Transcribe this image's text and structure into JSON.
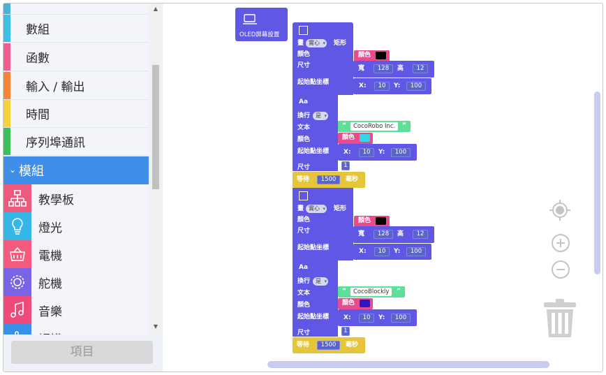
{
  "toolbox": {
    "categories": [
      {
        "label": "",
        "color": "#46b5d8"
      },
      {
        "label": "數組",
        "color": "#3ec0e6"
      },
      {
        "label": "函數",
        "color": "#f15f8e"
      },
      {
        "label": "輸入 / 輸出",
        "color": "#f58638"
      },
      {
        "label": "時間",
        "color": "#f5d23c"
      },
      {
        "label": "序列埠通訊",
        "color": "#3bbf5a"
      }
    ],
    "selected": {
      "label": "模組",
      "color": "#3f8ee9"
    },
    "modules": [
      {
        "label": "教學板",
        "icon": "board-icon",
        "color": "#ee5a7d"
      },
      {
        "label": "燈光",
        "icon": "bulb-icon",
        "color": "#36b7e8"
      },
      {
        "label": "電機",
        "icon": "motor-icon",
        "color": "#f35a7e"
      },
      {
        "label": "舵機",
        "icon": "servo-icon",
        "color": "#7a63e4"
      },
      {
        "label": "音樂",
        "icon": "music-icon",
        "color": "#ef4b7a"
      },
      {
        "label": "觸摸",
        "icon": "touch-icon",
        "color": "#3a8fe8"
      }
    ],
    "items_button": "項目"
  },
  "hat_block": {
    "label": "OLED屏幕設置",
    "icon": "screen-icon"
  },
  "rect_blocks": [
    {
      "draw_label": "畫",
      "mode": "實心",
      "shape_label": "矩形",
      "color_label": "顏色",
      "color_chip_label": "顏色",
      "color_value": "#000000",
      "size_label": "尺寸",
      "width_label": "寬",
      "width": "128",
      "height_label": "高",
      "height": "12",
      "origin_label": "起始點坐標",
      "x_label": "X:",
      "x": "10",
      "y_label": "Y:",
      "y": "100"
    },
    {
      "draw_label": "畫",
      "mode": "實心",
      "shape_label": "矩形",
      "color_label": "顏色",
      "color_chip_label": "顏色",
      "color_value": "#000000",
      "size_label": "尺寸",
      "width_label": "寬",
      "width": "128",
      "height_label": "高",
      "height": "12",
      "origin_label": "起始點坐標",
      "x_label": "X:",
      "x": "10",
      "y_label": "Y:",
      "y": "100"
    }
  ],
  "text_blocks": [
    {
      "header": "Aa",
      "wrap_label": "換行",
      "wrap_value": "是",
      "text_label": "文本",
      "text_value": "CocoRobo Inc.",
      "color_label": "顏色",
      "color_chip_label": "顏色",
      "color_value": "#35d6e8",
      "origin_label": "起始點坐標",
      "x_label": "X:",
      "x": "10",
      "y_label": "Y:",
      "y": "100",
      "size_label": "尺寸",
      "size_value": "1"
    },
    {
      "header": "Aa",
      "wrap_label": "換行",
      "wrap_value": "是",
      "text_label": "文本",
      "text_value": "CocoBlockly",
      "color_label": "顏色",
      "color_chip_label": "顏色",
      "color_value": "#2a18c8",
      "origin_label": "起始點坐標",
      "x_label": "X:",
      "x": "10",
      "y_label": "Y:",
      "y": "100",
      "size_label": "尺寸",
      "size_value": "1"
    }
  ],
  "wait_blocks": [
    {
      "label": "等待",
      "value": "1500",
      "unit": "毫秒"
    },
    {
      "label": "等待",
      "value": "1500",
      "unit": "毫秒"
    }
  ],
  "workspace_controls": {
    "recenter": "target-icon",
    "zoom_in": "plus-icon",
    "zoom_out": "minus-icon",
    "trash": "trash-icon"
  },
  "colors": {
    "display_block": "#6157e5",
    "wait_block": "#e5c53a",
    "string_block": "#5ee09a",
    "color_chip": "#e94b91"
  }
}
